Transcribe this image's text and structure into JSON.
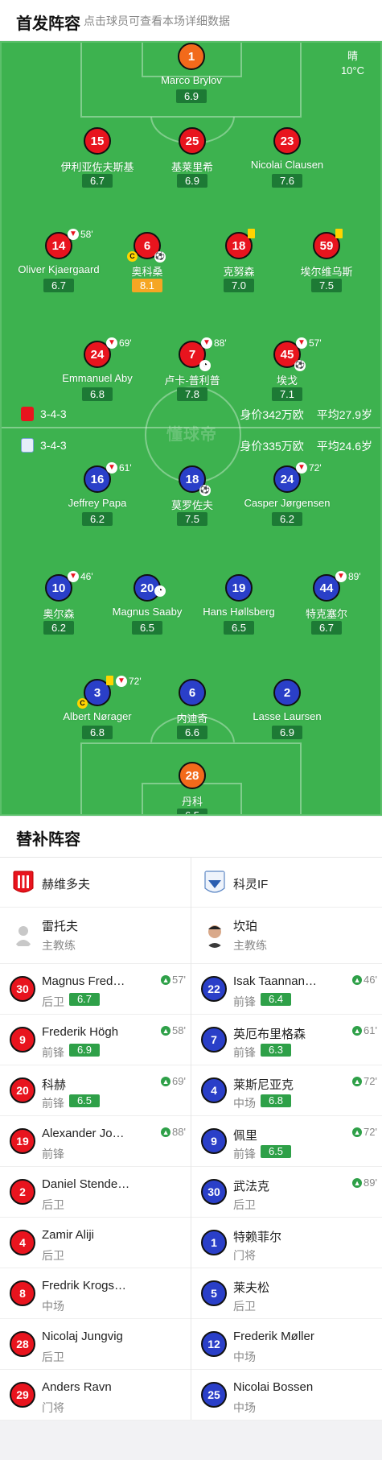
{
  "header": {
    "title": "首发阵容",
    "hint": "点击球员可查看本场详细数据"
  },
  "weather": {
    "condition": "晴",
    "temperature": "10°C"
  },
  "watermark": "懂球帝",
  "home": {
    "formation": "3-4-3",
    "value": "身价342万欧",
    "avg_age": "平均27.9岁",
    "color": "#e8141e",
    "players": [
      {
        "num": "1",
        "name": "Marco Brylov",
        "rating": "6.9"
      },
      {
        "num": "15",
        "name": "伊利亚佐夫斯基",
        "rating": "6.7"
      },
      {
        "num": "25",
        "name": "基莱里希",
        "rating": "6.9"
      },
      {
        "num": "23",
        "name": "Nicolai Clausen",
        "rating": "7.6"
      },
      {
        "num": "14",
        "name": "Oliver Kjaergaard",
        "rating": "6.7",
        "sub_time": "58'"
      },
      {
        "num": "6",
        "name": "奥科桑",
        "rating": "8.1"
      },
      {
        "num": "18",
        "name": "克努森",
        "rating": "7.0"
      },
      {
        "num": "59",
        "name": "埃尔维乌斯",
        "rating": "7.5"
      },
      {
        "num": "24",
        "name": "Emmanuel Aby",
        "rating": "6.8",
        "sub_time": "69'"
      },
      {
        "num": "7",
        "name": "卢卡-普利普",
        "rating": "7.8",
        "sub_time": "88'"
      },
      {
        "num": "45",
        "name": "埃戈",
        "rating": "7.1",
        "sub_time": "57'"
      }
    ]
  },
  "away": {
    "formation": "3-4-3",
    "value": "身价335万欧",
    "avg_age": "平均24.6岁",
    "color": "#2a3fc8",
    "players": [
      {
        "num": "16",
        "name": "Jeffrey Papa",
        "rating": "6.2",
        "sub_time": "61'"
      },
      {
        "num": "18",
        "name": "莫罗佐夫",
        "rating": "7.5"
      },
      {
        "num": "24",
        "name": "Casper Jørgensen",
        "rating": "6.2",
        "sub_time": "72'"
      },
      {
        "num": "10",
        "name": "奥尔森",
        "rating": "6.2",
        "sub_time": "46'"
      },
      {
        "num": "20",
        "name": "Magnus Saaby",
        "rating": "6.5"
      },
      {
        "num": "19",
        "name": "Hans Høllsberg",
        "rating": "6.5"
      },
      {
        "num": "44",
        "name": "特克塞尔",
        "rating": "6.7",
        "sub_time": "89'"
      },
      {
        "num": "3",
        "name": "Albert Nørager",
        "rating": "6.8",
        "sub_time": "72'"
      },
      {
        "num": "6",
        "name": "内迪奇",
        "rating": "6.6"
      },
      {
        "num": "2",
        "name": "Lasse Laursen",
        "rating": "6.9"
      },
      {
        "num": "28",
        "name": "丹科",
        "rating": "6.5"
      }
    ]
  },
  "subs": {
    "title": "替补阵容",
    "home_team": "赫维多夫",
    "away_team": "科灵IF",
    "home_coach": {
      "name": "雷托夫",
      "role": "主教练"
    },
    "away_coach": {
      "name": "坎珀",
      "role": "主教练"
    },
    "home_list": [
      {
        "num": "30",
        "name": "Magnus Fred…",
        "pos": "后卫",
        "rating": "6.7",
        "time": "57'"
      },
      {
        "num": "9",
        "name": "Frederik Högh",
        "pos": "前锋",
        "rating": "6.9",
        "time": "58'"
      },
      {
        "num": "20",
        "name": "科赫",
        "pos": "前锋",
        "rating": "6.5",
        "time": "69'"
      },
      {
        "num": "19",
        "name": "Alexander Jo…",
        "pos": "前锋",
        "rating": "",
        "time": "88'"
      },
      {
        "num": "2",
        "name": "Daniel Stende…",
        "pos": "后卫",
        "rating": "",
        "time": ""
      },
      {
        "num": "4",
        "name": "Zamir Aliji",
        "pos": "后卫",
        "rating": "",
        "time": ""
      },
      {
        "num": "8",
        "name": "Fredrik Krogs…",
        "pos": "中场",
        "rating": "",
        "time": ""
      },
      {
        "num": "28",
        "name": "Nicolaj Jungvig",
        "pos": "后卫",
        "rating": "",
        "time": ""
      },
      {
        "num": "29",
        "name": "Anders Ravn",
        "pos": "门将",
        "rating": "",
        "time": ""
      }
    ],
    "away_list": [
      {
        "num": "22",
        "name": "Isak Taannan…",
        "pos": "前锋",
        "rating": "6.4",
        "time": "46'"
      },
      {
        "num": "7",
        "name": "英厄布里格森",
        "pos": "前锋",
        "rating": "6.3",
        "time": "61'"
      },
      {
        "num": "4",
        "name": "莱斯尼亚克",
        "pos": "中场",
        "rating": "6.8",
        "time": "72'"
      },
      {
        "num": "9",
        "name": "佩里",
        "pos": "前锋",
        "rating": "6.5",
        "time": "72'"
      },
      {
        "num": "30",
        "name": "武法克",
        "pos": "后卫",
        "rating": "",
        "time": "89'"
      },
      {
        "num": "1",
        "name": "特赖菲尔",
        "pos": "门将",
        "rating": "",
        "time": ""
      },
      {
        "num": "5",
        "name": "莱夫松",
        "pos": "后卫",
        "rating": "",
        "time": ""
      },
      {
        "num": "12",
        "name": "Frederik Møller",
        "pos": "中场",
        "rating": "",
        "time": ""
      },
      {
        "num": "25",
        "name": "Nicolai Bossen",
        "pos": "中场",
        "rating": "",
        "time": ""
      }
    ]
  }
}
